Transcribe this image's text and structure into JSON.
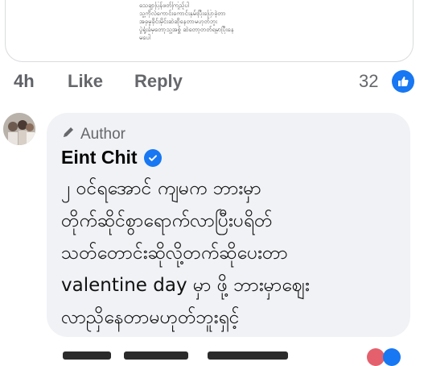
{
  "quoted_comment": {
    "lines": [
      "သေချာပြန်ဖတ်ကြည့်ပါ",
      "သူ့ကိုလဲကောင်းကောင်းနှမ်းပြီးပြောခဲ့တာ",
      "အခုမှုခိုင်းမိုင်းဆဲဆိုနေတာမဟုတ်ဘူး",
      "ပွဲရှုံးခံမှတော့သူ့အစ္စ် ဆဲတော့တတ်ရမှာပြီးနေ",
      "မပေါ"
    ]
  },
  "actions": {
    "time": "4h",
    "like": "Like",
    "reply": "Reply",
    "reaction_count": "32"
  },
  "comment": {
    "author_badge": "Author",
    "name": "Eint Chit",
    "body_lines": [
      "၂ ဝင်ရအောင် ကျမက ဘားမှာ",
      "တိုက်ဆိုင်စွာရောက်လာပြီးပရိတ်",
      "သတ်တောင်းဆိုလို့တက်ဆိုပေးတာ",
      "valentine day မှာ ဖို့ ဘားမှာဈေး",
      "လာညှိနေတာမဟုတ်ဘူးရှင့်"
    ]
  },
  "colors": {
    "facebook_blue": "#1877f2",
    "bubble_bg": "#f0f2f5",
    "muted_text": "#65676b"
  },
  "icons": {
    "author": "pencil-icon",
    "verified": "verified-check-icon",
    "reaction": "like-thumb-icon"
  }
}
